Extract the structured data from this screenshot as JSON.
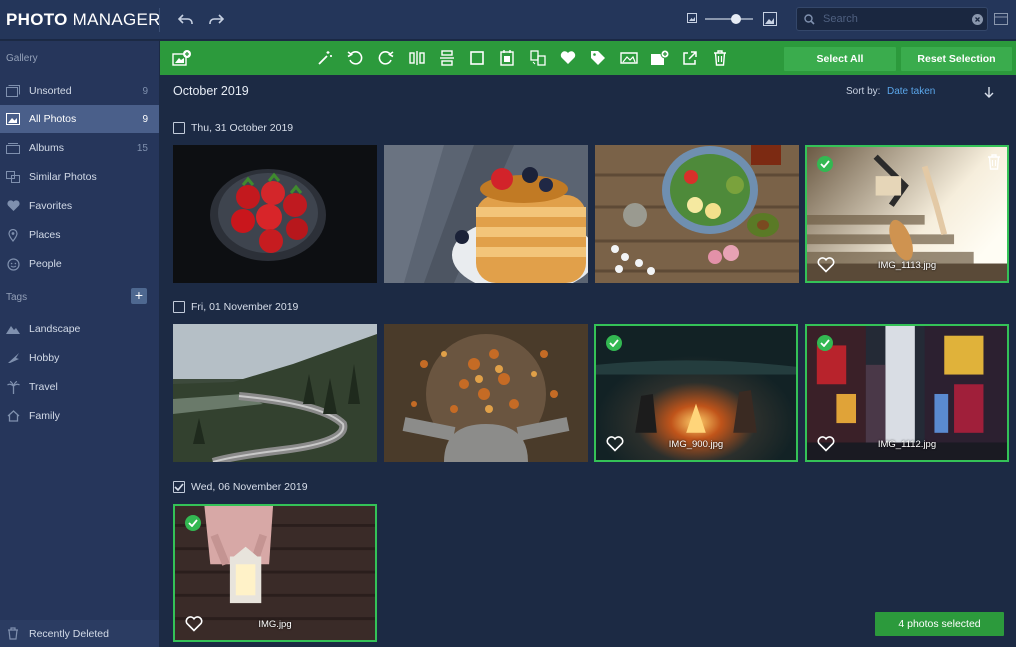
{
  "app": {
    "brand_bold": "PHOTO",
    "brand_light": " MANAGER"
  },
  "search": {
    "placeholder": "Search"
  },
  "sidebar": {
    "gallery_header": "Gallery",
    "items": [
      {
        "label": "Unsorted",
        "count": "9",
        "icon": "unsorted-icon"
      },
      {
        "label": "All Photos",
        "count": "9",
        "icon": "photos-icon",
        "active": true
      },
      {
        "label": "Albums",
        "count": "15",
        "icon": "albums-icon"
      },
      {
        "label": "Similar Photos",
        "count": "",
        "icon": "similar-icon"
      },
      {
        "label": "Favorites",
        "count": "",
        "icon": "heart-icon"
      },
      {
        "label": "Places",
        "count": "",
        "icon": "pin-icon"
      },
      {
        "label": "People",
        "count": "",
        "icon": "face-icon"
      }
    ],
    "tags_header": "Tags",
    "tags": [
      {
        "label": "Landscape",
        "icon": "landscape-icon"
      },
      {
        "label": "Hobby",
        "icon": "hobby-icon"
      },
      {
        "label": "Travel",
        "icon": "palm-icon"
      },
      {
        "label": "Family",
        "icon": "house-icon"
      }
    ],
    "recently_deleted": "Recently Deleted"
  },
  "toolbar": {
    "select_all": "Select All",
    "reset_selection": "Reset Selection"
  },
  "content": {
    "month": "October 2019",
    "sort_label": "Sort by:",
    "sort_value": "Date taken",
    "groups": [
      {
        "date": "Thu, 31 October 2019",
        "checked": false
      },
      {
        "date": "Fri, 01 November 2019",
        "checked": false
      },
      {
        "date": "Wed, 06 November 2019",
        "checked": true
      }
    ],
    "photos": [
      {
        "file": "",
        "selected": false
      },
      {
        "file": "",
        "selected": false
      },
      {
        "file": "",
        "selected": false
      },
      {
        "file": "IMG_1113.jpg",
        "selected": true
      },
      {
        "file": "",
        "selected": false
      },
      {
        "file": "",
        "selected": false
      },
      {
        "file": "IMG_900.jpg",
        "selected": true
      },
      {
        "file": "IMG_1112.jpg",
        "selected": true
      },
      {
        "file": "IMG.jpg",
        "selected": true
      }
    ]
  },
  "status": {
    "selected_text": "4 photos selected"
  },
  "colors": {
    "accent_green": "#2c9a3c",
    "background": "#1c2a44",
    "sidebar": "#26365b",
    "link": "#5aa6ea"
  }
}
